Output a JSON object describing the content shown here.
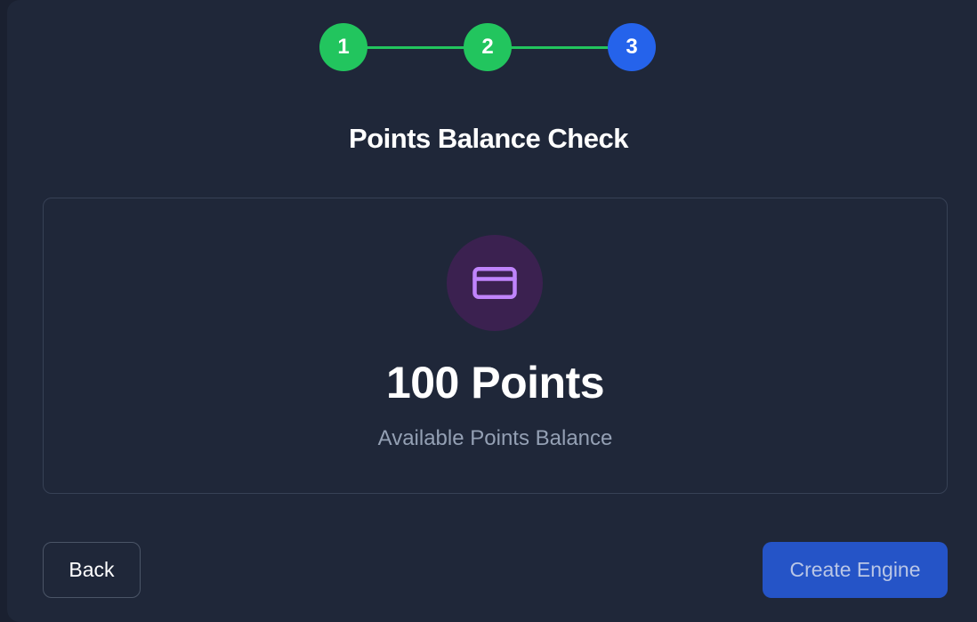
{
  "stepper": {
    "steps": [
      {
        "label": "1",
        "state": "complete",
        "color": "#22c55e"
      },
      {
        "label": "2",
        "state": "complete",
        "color": "#22c55e"
      },
      {
        "label": "3",
        "state": "active",
        "color": "#2563eb"
      }
    ]
  },
  "title": "Points Balance Check",
  "balance": {
    "icon": "credit-card-icon",
    "amount": "100 Points",
    "label": "Available Points Balance"
  },
  "actions": {
    "back_label": "Back",
    "create_label": "Create Engine"
  },
  "colors": {
    "complete": "#22c55e",
    "active": "#2563eb",
    "icon_accent": "#c084fc",
    "primary_button": "#2554c7"
  }
}
